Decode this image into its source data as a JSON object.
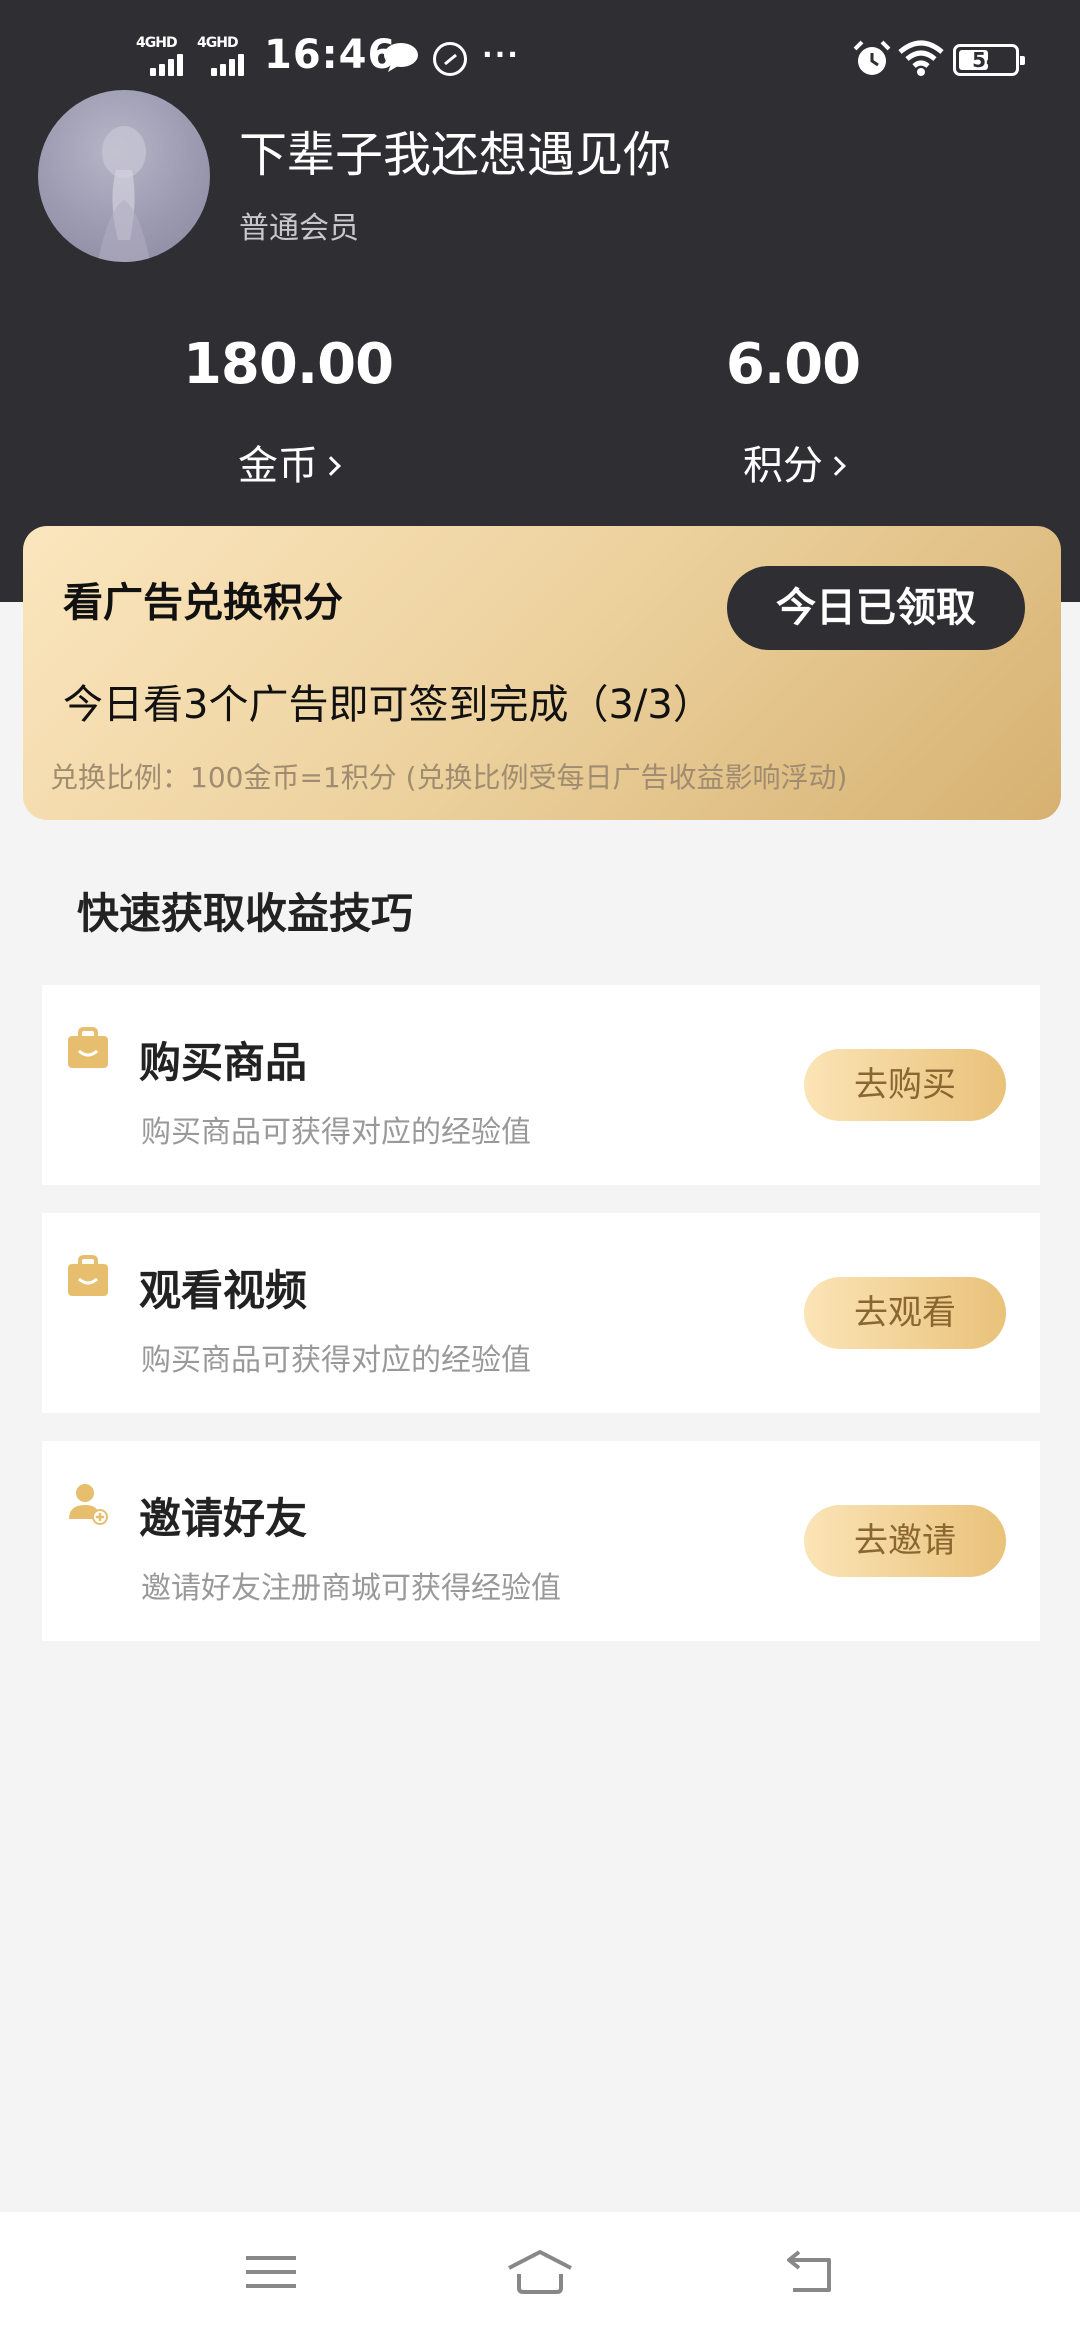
{
  "statusbar": {
    "signal1_tag": "4GHD",
    "signal2_tag": "4GHD",
    "time": "16:46",
    "more_dots": "···",
    "battery_level": 54,
    "battery_text": "54"
  },
  "profile": {
    "username": "下辈子我还想遇见你",
    "member_level": "普通会员"
  },
  "stats": {
    "coins_value": "180.00",
    "coins_label": "金币",
    "points_value": "6.00",
    "points_label": "积分"
  },
  "ad_card": {
    "title": "看广告兑换积分",
    "claim_button": "今日已领取",
    "subtitle": "今日看3个广告即可签到完成（3/3）",
    "note": "兑换比例：100金币=1积分 (兑换比例受每日广告收益影响浮动)"
  },
  "tips": {
    "section_title": "快速获取收益技巧",
    "items": [
      {
        "icon": "shopping-bag-icon",
        "title": "购买商品",
        "desc": "购买商品可获得对应的经验值",
        "button": "去购买"
      },
      {
        "icon": "shopping-bag-icon",
        "title": "观看视频",
        "desc": "购买商品可获得对应的经验值",
        "button": "去观看"
      },
      {
        "icon": "add-friend-icon",
        "title": "邀请好友",
        "desc": "邀请好友注册商城可获得经验值",
        "button": "去邀请"
      }
    ]
  },
  "colors": {
    "header_bg": "#2e2e33",
    "gold_light": "#fbe6be",
    "gold_dark": "#d6b171",
    "icon_gold": "#e6be6e"
  }
}
